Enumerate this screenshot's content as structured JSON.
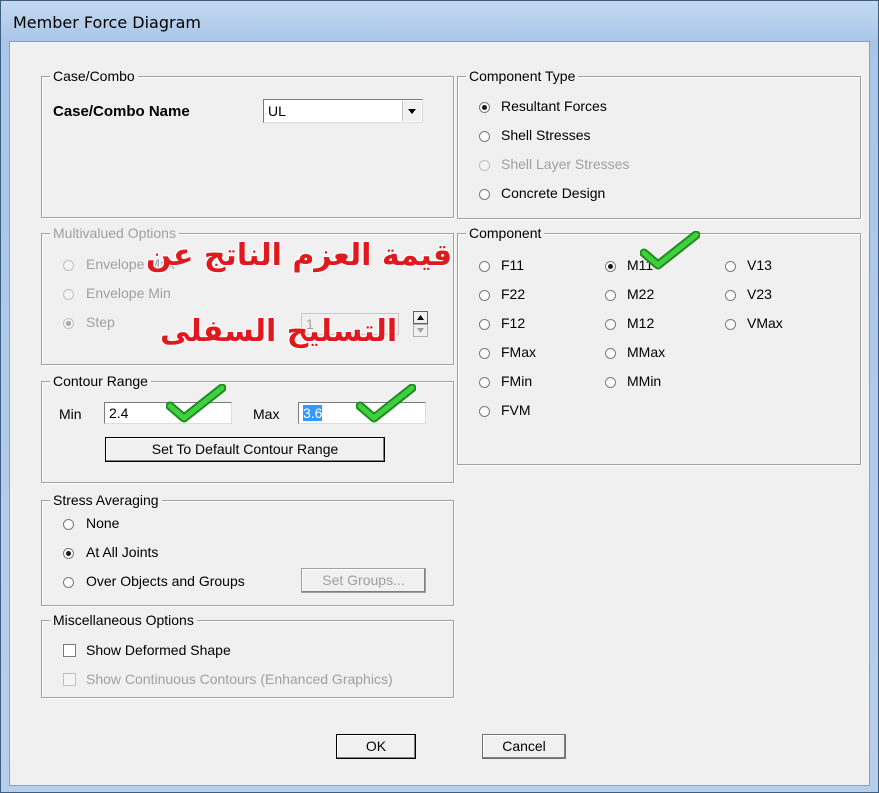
{
  "window": {
    "title": "Member Force Diagram"
  },
  "case_combo": {
    "group_title": "Case/Combo",
    "name_label": "Case/Combo Name",
    "selected": "UL"
  },
  "multivalued": {
    "group_title": "Multivalued Options",
    "options": [
      "Envelope Max",
      "Envelope Min",
      "Step"
    ],
    "step_value": "1"
  },
  "annotation": {
    "line1": "قيمة العزم الناتج عن",
    "line2": "التسليح السفلى",
    "check_color": "#2db32d"
  },
  "contour_range": {
    "group_title": "Contour Range",
    "min_label": "Min",
    "min_value": "2.4",
    "max_label": "Max",
    "max_value": "3.6",
    "default_button": "Set To Default Contour Range"
  },
  "stress_averaging": {
    "group_title": "Stress Averaging",
    "options": [
      "None",
      "At All Joints",
      "Over Objects and Groups"
    ],
    "set_groups_button": "Set Groups..."
  },
  "misc": {
    "group_title": "Miscellaneous Options",
    "show_deformed": "Show Deformed Shape",
    "show_continuous": "Show Continuous Contours  (Enhanced Graphics)"
  },
  "component_type": {
    "group_title": "Component Type",
    "options": [
      "Resultant Forces",
      "Shell Stresses",
      "Shell Layer Stresses",
      "Concrete Design"
    ]
  },
  "component": {
    "group_title": "Component",
    "col1": [
      "F11",
      "F22",
      "F12",
      "FMax",
      "FMin",
      "FVM"
    ],
    "col2": [
      "M11",
      "M22",
      "M12",
      "MMax",
      "MMin"
    ],
    "col3": [
      "V13",
      "V23",
      "VMax"
    ]
  },
  "buttons": {
    "ok": "OK",
    "cancel": "Cancel"
  }
}
